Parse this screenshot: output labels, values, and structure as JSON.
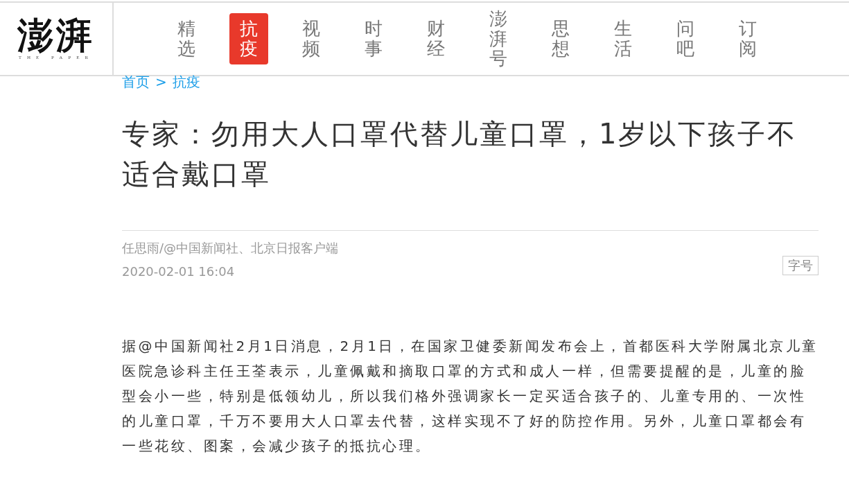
{
  "logo": {
    "name": "澎湃",
    "subtitle": "THE PAPER"
  },
  "nav": [
    {
      "label": "精选",
      "selected": false
    },
    {
      "label": "抗疫",
      "selected": true
    },
    {
      "label": "视频",
      "selected": false
    },
    {
      "label": "时事",
      "selected": false
    },
    {
      "label": "财经",
      "selected": false
    },
    {
      "label": "澎湃号",
      "selected": false
    },
    {
      "label": "思想",
      "selected": false
    },
    {
      "label": "生活",
      "selected": false
    },
    {
      "label": "问吧",
      "selected": false
    },
    {
      "label": "订阅",
      "selected": false
    }
  ],
  "breadcrumb": [
    "首页",
    ">",
    "抗疫"
  ],
  "article": {
    "title": "专家：勿用大人口罩代替儿童口罩，1岁以下孩子不适合戴口罩",
    "source": "任思雨/@中国新闻社、北京日报客户端",
    "date": "2020-02-01 16:04",
    "font_size_button": "字号",
    "body": "据@中国新闻社2月1日消息，2月1日，在国家卫健委新闻发布会上，首都医科大学附属北京儿童医院急诊科主任王荃表示，儿童佩戴和摘取口罩的方式和成人一样，但需要提醒的是，儿童的脸型会小一些，特别是低领幼儿，所以我们格外强调家长一定买适合孩子的、儿童专用的、一次性的儿童口罩，千万不要用大人口罩去代替，这样实现不了好的防控作用。另外，儿童口罩都会有一些花纹、图案，会减少孩子的抵抗心理。"
  }
}
